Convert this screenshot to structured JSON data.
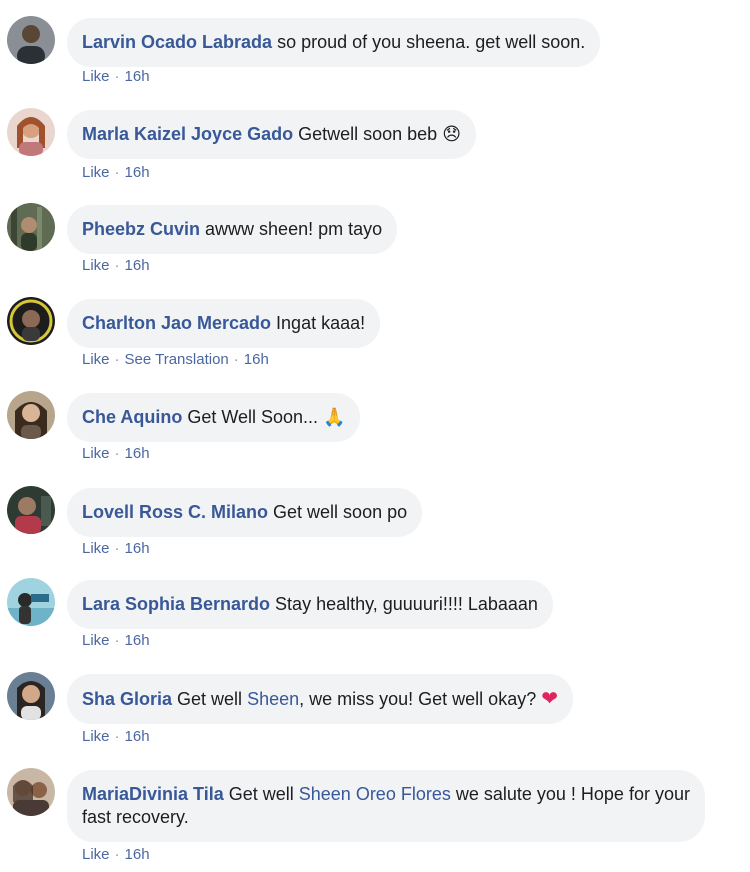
{
  "comments": [
    {
      "author": "Larvin Ocado Labrada",
      "text": " so proud of you sheena. get well soon.",
      "like": "Like",
      "time": "16h"
    },
    {
      "author": "Marla Kaizel Joyce Gado",
      "text": " Getwell soon beb ",
      "emoji": "😞",
      "like": "Like",
      "time": "16h"
    },
    {
      "author": "Pheebz Cuvin",
      "text": " awww sheen! pm tayo",
      "like": "Like",
      "time": "16h"
    },
    {
      "author": "Charlton Jao Mercado",
      "text": " Ingat kaaa!",
      "like": "Like",
      "translation": "See Translation",
      "time": "16h"
    },
    {
      "author": "Che Aquino",
      "text": " Get Well Soon... ",
      "emoji": "🙏",
      "like": "Like",
      "time": "16h"
    },
    {
      "author": "Lovell Ross C. Milano",
      "text": " Get well soon po",
      "like": "Like",
      "time": "16h"
    },
    {
      "author": "Lara Sophia Bernardo",
      "text": " Stay healthy, guuuuri!!!! Labaaan",
      "like": "Like",
      "time": "16h"
    },
    {
      "author": "Sha Gloria",
      "text_before": " Get well ",
      "tag": "Sheen",
      "text_after": ", we miss you! Get well okay? ",
      "emoji": "❤",
      "like": "Like",
      "time": "16h"
    },
    {
      "author": "MariaDivinia Tila",
      "text_before": " Get well ",
      "tag": "Sheen Oreo Flores",
      "text_after": " we salute you ! Hope for your fast recovery.",
      "like": "Like",
      "time": "16h"
    }
  ],
  "colors": {
    "author": "#385898",
    "bubble": "#f2f3f5",
    "meta": "#90949c",
    "heart": "#e0245e"
  },
  "icons": {
    "avatar": "profile-photo",
    "sad_emoji": "disappointed-face",
    "pray_emoji": "folded-hands",
    "heart_emoji": "red-heart"
  }
}
